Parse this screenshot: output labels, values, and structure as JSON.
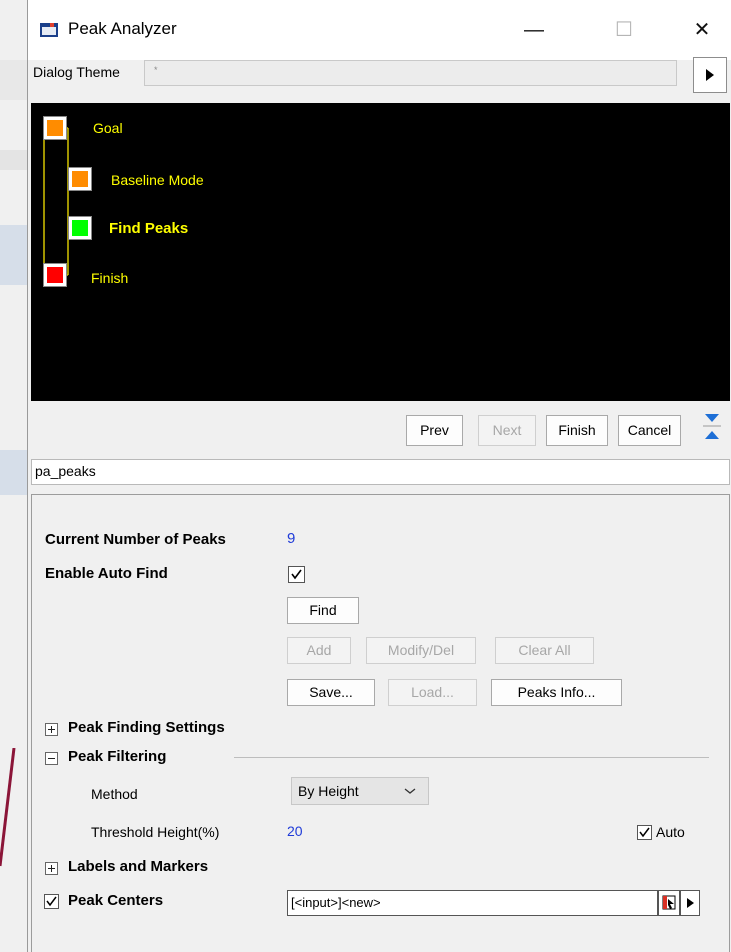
{
  "window": {
    "title": "Peak Analyzer"
  },
  "titlebar": {
    "minimize_glyph": "—",
    "maximize_glyph": "☐",
    "close_glyph": "✕"
  },
  "dialog_theme": {
    "label": "Dialog Theme",
    "value": "*"
  },
  "flow": {
    "steps": [
      {
        "label": "Goal",
        "color": "#ff8c00",
        "bold": false
      },
      {
        "label": "Baseline Mode",
        "color": "#ff8c00",
        "bold": false
      },
      {
        "label": "Find Peaks",
        "color": "#00ff00",
        "bold": true
      },
      {
        "label": "Finish",
        "color": "#ff0000",
        "bold": false
      }
    ],
    "label_color": "#ffff00"
  },
  "wizard_buttons": {
    "prev": "Prev",
    "next": "Next",
    "finish": "Finish",
    "cancel": "Cancel"
  },
  "page_name": "pa_peaks",
  "panel": {
    "current_peaks_label": "Current Number of Peaks",
    "current_peaks_value": "9",
    "auto_find_label": "Enable Auto Find",
    "auto_find_checked": true,
    "find_button": "Find",
    "add_button": "Add",
    "modify_button": "Modify/Del",
    "clear_button": "Clear All",
    "save_button": "Save...",
    "load_button": "Load...",
    "peaks_info_button": "Peaks Info...",
    "peak_finding_settings": "Peak Finding Settings",
    "peak_filtering": "Peak Filtering",
    "method_label": "Method",
    "method_value": "By Height",
    "threshold_label": "Threshold Height(%)",
    "threshold_value": "20",
    "auto_label": "Auto",
    "auto_checked": true,
    "labels_markers": "Labels and Markers",
    "peak_centers": "Peak Centers",
    "peak_centers_checked": true,
    "peak_centers_value": "[<input>]<new>"
  },
  "colors": {
    "value_blue": "#1f3bd8",
    "accent_line": "#8b1538"
  }
}
